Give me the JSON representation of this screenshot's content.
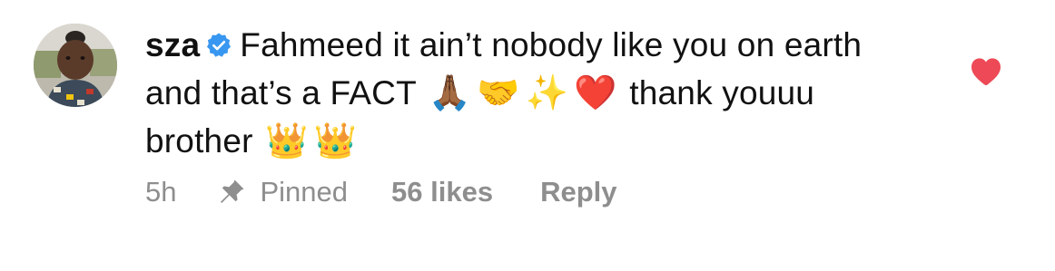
{
  "comment": {
    "username": "sza",
    "verified_icon": "verified-badge-icon",
    "text_part_1": "Fahmeed it ain’t nobody like you on earth and that’s a FACT",
    "emoji_1": "🙏🏾",
    "emoji_2": "🤝",
    "emoji_3": "✨",
    "emoji_4": "❤️",
    "text_part_2": "thank youuu brother",
    "emoji_5": "👑",
    "emoji_6": "👑"
  },
  "meta": {
    "time": "5h",
    "pinned_label": "Pinned",
    "likes": "56 likes",
    "reply_label": "Reply"
  },
  "colors": {
    "verified_blue": "#3897f0",
    "heart_red": "#ed4956",
    "meta_gray": "#8e8e8e"
  },
  "like_state": "liked"
}
